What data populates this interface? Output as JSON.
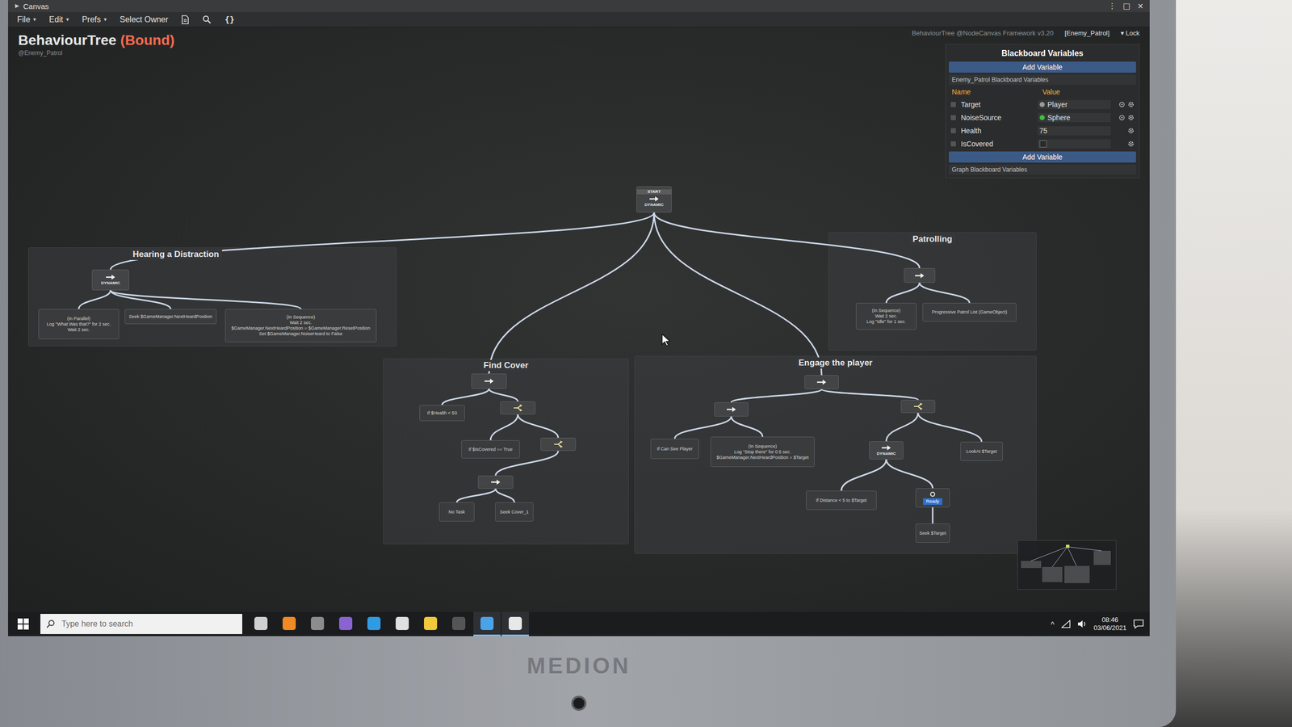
{
  "window": {
    "title": "Canvas",
    "controls": [
      "⋮",
      "□",
      "×"
    ]
  },
  "menu": [
    {
      "label": "File",
      "arrow": "▾"
    },
    {
      "label": "Edit",
      "arrow": "▾"
    },
    {
      "label": "Prefs",
      "arrow": "▾"
    },
    {
      "label": "Select Owner",
      "arrow": ""
    }
  ],
  "toolbar_glyphs": [
    "{}"
  ],
  "graph": {
    "title": "BehaviourTree",
    "badge": "(Bound)",
    "owner": "@Enemy_Patrol",
    "info": "BehaviourTree @NodeCanvas Framework v3.20",
    "agent": "[Enemy_Patrol]",
    "lock_arrow": "▾",
    "lock": "Lock",
    "groups": [
      {
        "title": "Hearing a Distraction"
      },
      {
        "title": "Patrolling"
      },
      {
        "title": "Find Cover"
      },
      {
        "title": "Engage the player"
      }
    ],
    "tree": {
      "kind": "root",
      "top": "START",
      "label": "DYNAMIC",
      "children": [
        {
          "kind": "sequencer",
          "label": "DYNAMIC",
          "children": [
            {
              "kind": "action",
              "lines": [
                "(In Parallel)",
                "Log \"What Was that?\" for 2 sec.",
                "Wait 2 sec."
              ]
            },
            {
              "kind": "action",
              "lines": [
                "Seek $GameManager.NextHeardPosition"
              ]
            },
            {
              "kind": "action",
              "lines": [
                "(In Sequence)",
                "Wait 2 sec.",
                "$GameManager.NextHeardPosition = $GameManager.ResetPosition",
                "Set $GameManager.NoiseHeard to False"
              ]
            }
          ]
        },
        {
          "kind": "sequencer",
          "label": "",
          "children": [
            {
              "kind": "condition",
              "lines": [
                "If $Health < 50"
              ]
            },
            {
              "kind": "selector",
              "label": "",
              "children": [
                {
                  "kind": "condition",
                  "lines": [
                    "If $IsCovered == True"
                  ]
                },
                {
                  "kind": "selector",
                  "label": "",
                  "children": [
                    {
                      "kind": "sequencer",
                      "label": "",
                      "children": [
                        {
                          "kind": "action",
                          "lines": [
                            "No Task"
                          ]
                        },
                        {
                          "kind": "action",
                          "lines": [
                            "Seek Cover_1"
                          ]
                        }
                      ]
                    }
                  ]
                }
              ]
            }
          ]
        },
        {
          "kind": "sequencer",
          "label": "",
          "children": [
            {
              "kind": "sequencer",
              "label": "",
              "children": [
                {
                  "kind": "condition",
                  "lines": [
                    "If Can See Player"
                  ]
                },
                {
                  "kind": "action",
                  "lines": [
                    "(In Sequence)",
                    "Log \"Stop there\" for 0.5 sec.",
                    "$GameManager.NextHeardPosition = $Target"
                  ]
                }
              ]
            },
            {
              "kind": "selector",
              "label": "",
              "children": [
                {
                  "kind": "sequencer",
                  "label": "DYNAMIC",
                  "children": [
                    {
                      "kind": "condition",
                      "lines": [
                        "If Distance < 5 to $Target"
                      ]
                    },
                    {
                      "kind": "decorator",
                      "label": "Ready",
                      "highlighted": true,
                      "children": [
                        {
                          "kind": "action",
                          "lines": [
                            "Seek $Target"
                          ]
                        }
                      ]
                    }
                  ]
                },
                {
                  "kind": "action",
                  "lines": [
                    "LookAt $Target"
                  ]
                }
              ]
            }
          ]
        },
        {
          "kind": "sequencer",
          "label": "",
          "children": [
            {
              "kind": "action",
              "lines": [
                "(In Sequence)",
                "Wait 2 sec.",
                "Log \"Idle\" for 1 sec."
              ]
            },
            {
              "kind": "action",
              "lines": [
                "Progressive Patrol List (GameObject)"
              ]
            }
          ]
        }
      ]
    }
  },
  "blackboard": {
    "title": "Blackboard Variables",
    "add_button": "Add Variable",
    "section": "Enemy_Patrol Blackboard Variables",
    "columns": [
      "Name",
      "Value"
    ],
    "variables": [
      {
        "name": "Target",
        "kind": "object",
        "value": "Player",
        "color": "#9a9a9a"
      },
      {
        "name": "NoiseSource",
        "kind": "object",
        "value": "Sphere",
        "color": "#3fbf3f"
      },
      {
        "name": "Health",
        "kind": "number",
        "value": "75"
      },
      {
        "name": "IsCovered",
        "kind": "bool",
        "checked": false
      }
    ],
    "add_button_2": "Add Variable",
    "graph_section": "Graph Blackboard Variables"
  },
  "taskbar": {
    "search_placeholder": "Type here to search",
    "tray_arrow": "^",
    "time": "08:46",
    "date": "03/06/2021",
    "apps": [
      {
        "running": false,
        "color": "#d0d0d0"
      },
      {
        "running": false,
        "color": "#f08a24"
      },
      {
        "running": false,
        "color": "#8c8c8c"
      },
      {
        "running": false,
        "color": "#8a63d2"
      },
      {
        "running": false,
        "color": "#2f9be3"
      },
      {
        "running": false,
        "color": "#e0e0e0"
      },
      {
        "running": false,
        "color": "#f3c83b"
      },
      {
        "running": false,
        "color": "#555555"
      },
      {
        "running": true,
        "color": "#4aa3e8"
      },
      {
        "running": true,
        "color": "#e8e8e8"
      }
    ]
  },
  "bezel": {
    "brand": "MEDION"
  }
}
